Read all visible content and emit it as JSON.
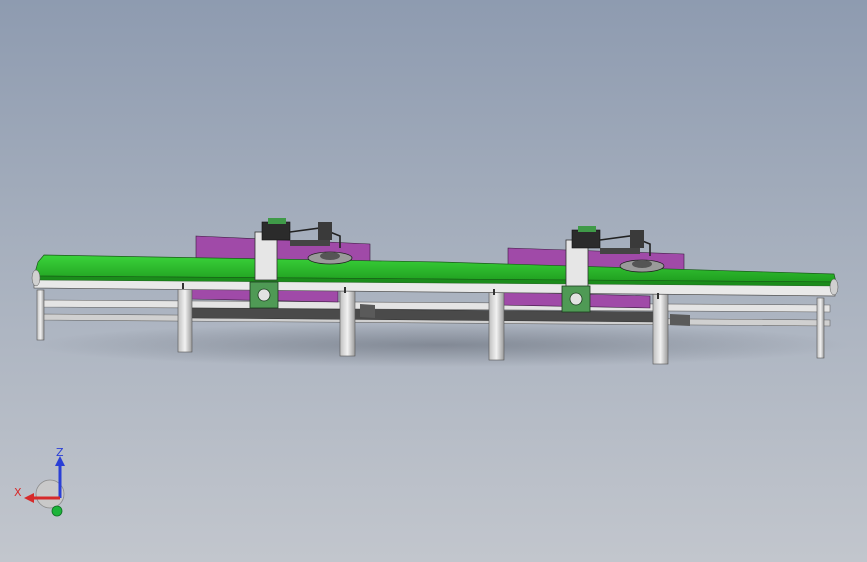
{
  "view": {
    "background_top": "#8e9bb0",
    "background_bottom": "#c2c6cd"
  },
  "model": {
    "belt_color": "#2fc12f",
    "panel_color": "#a04aa8",
    "frame_color": "#d8d8d8",
    "bracket_color": "#4f9a55",
    "stations": [
      "station-left",
      "station-right"
    ]
  },
  "triad": {
    "z_label": "Z",
    "x_label": "X",
    "z_color": "#2a3fd6",
    "x_color": "#d62a2a",
    "y_color": "#1db43a"
  }
}
